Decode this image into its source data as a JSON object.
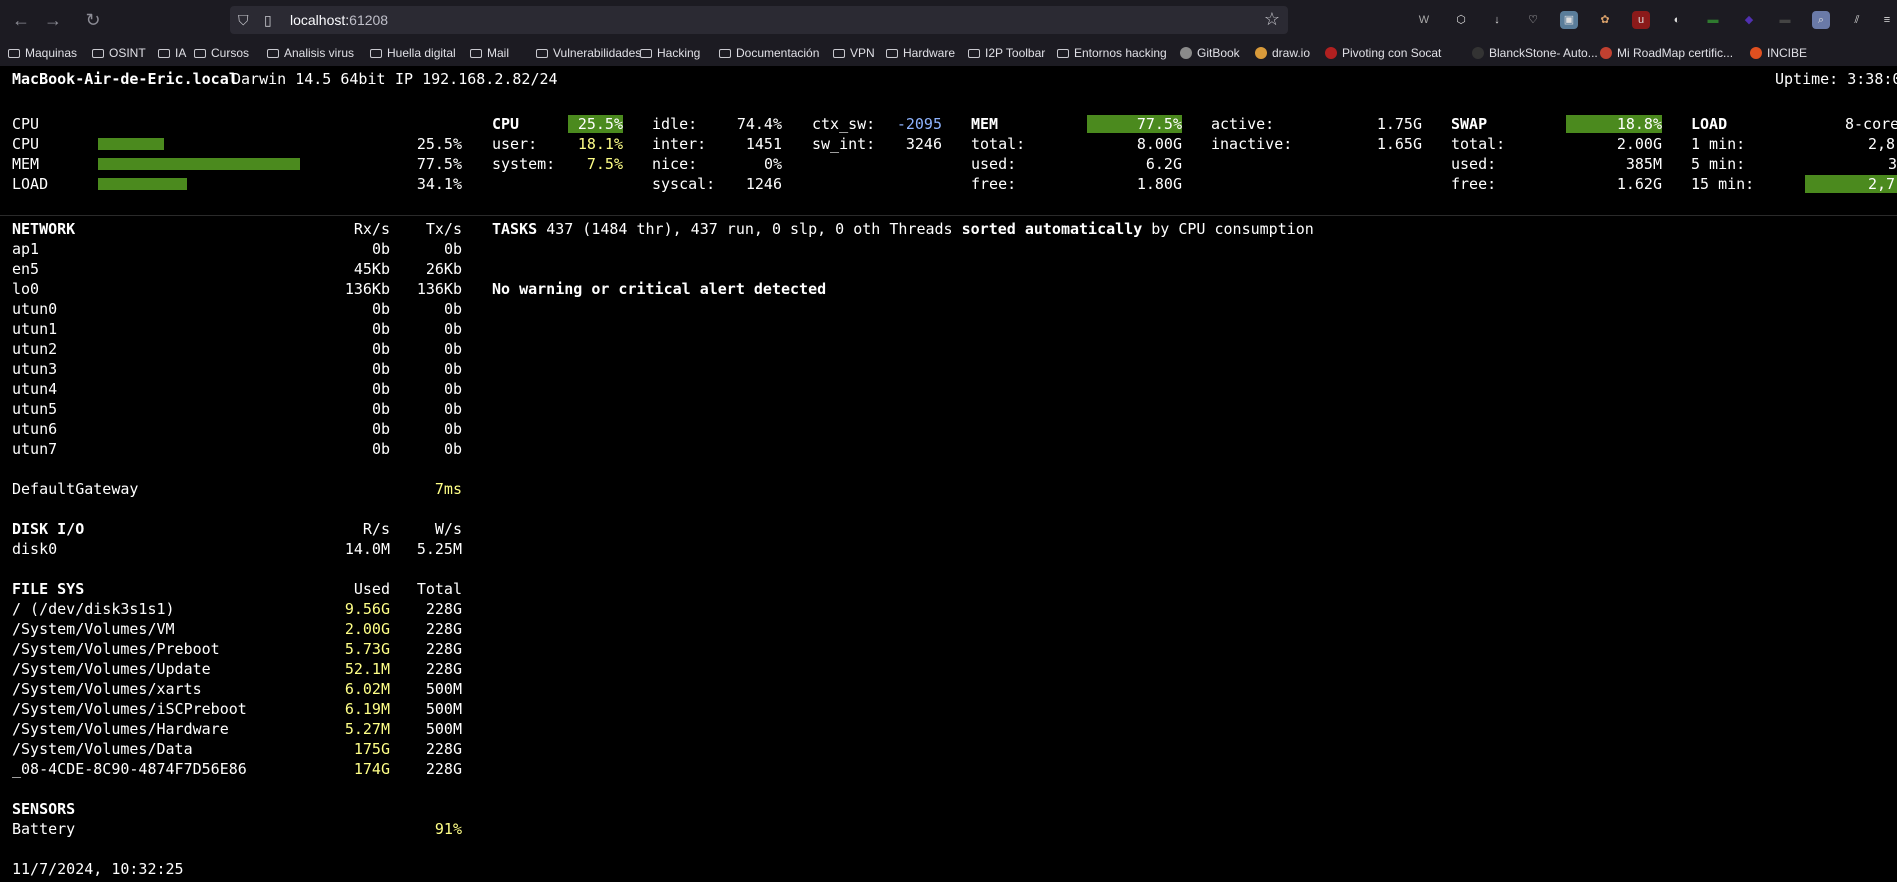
{
  "browser": {
    "url_host": "localhost:",
    "url_port": "61208",
    "bookmarks": [
      {
        "label": "Maquinas",
        "kind": "folder"
      },
      {
        "label": "OSINT",
        "kind": "folder"
      },
      {
        "label": "IA",
        "kind": "folder"
      },
      {
        "label": "Cursos",
        "kind": "folder"
      },
      {
        "label": "Analisis virus",
        "kind": "folder"
      },
      {
        "label": "Huella digital",
        "kind": "folder"
      },
      {
        "label": "Mail",
        "kind": "folder"
      },
      {
        "label": "Vulnerabilidades",
        "kind": "folder"
      },
      {
        "label": "Hacking",
        "kind": "folder"
      },
      {
        "label": "Documentación",
        "kind": "folder"
      },
      {
        "label": "VPN",
        "kind": "folder"
      },
      {
        "label": "Hardware",
        "kind": "folder"
      },
      {
        "label": "I2P Toolbar",
        "kind": "folder"
      },
      {
        "label": "Entornos hacking",
        "kind": "folder"
      },
      {
        "label": "GitBook",
        "kind": "site"
      },
      {
        "label": "draw.io",
        "kind": "site"
      },
      {
        "label": "Pivoting con Socat",
        "kind": "site"
      },
      {
        "label": "BlanckStone- Auto...",
        "kind": "site"
      },
      {
        "label": "Mi RoadMap certific...",
        "kind": "site"
      },
      {
        "label": "INCIBE",
        "kind": "site"
      }
    ]
  },
  "header": {
    "hostname": "MacBook-Air-de-Eric.local",
    "os": "Darwin 14.5 64bit",
    "ip": "IP 192.168.2.82/24",
    "uptime": "Uptime: 3:38:0"
  },
  "quicklook": {
    "rows": [
      {
        "label": "CPU",
        "value": "",
        "fill": null
      },
      {
        "label": "CPU",
        "value": "25.5%",
        "fill": 0.255
      },
      {
        "label": "MEM",
        "value": "77.5%",
        "fill": 0.775
      },
      {
        "label": "LOAD",
        "value": "34.1%",
        "fill": 0.341
      }
    ]
  },
  "cpu": {
    "title": "CPU",
    "total": "25.5%",
    "total_fraction": 0.255,
    "user_label": "user:",
    "user": "18.1%",
    "system_label": "system:",
    "system": "7.5%",
    "idle_label": "idle:",
    "idle": "74.4%",
    "inter_label": "inter:",
    "inter": "1451",
    "nice_label": "nice:",
    "nice": "0%",
    "syscal_label": "syscal:",
    "syscal": "1246",
    "ctx_sw_label": "ctx_sw:",
    "ctx_sw": "-2095",
    "sw_int_label": "sw_int:",
    "sw_int": "3246"
  },
  "mem": {
    "title": "MEM",
    "percent": "77.5%",
    "percent_fraction": 0.775,
    "total_label": "total:",
    "total": "8.00G",
    "used_label": "used:",
    "used": "6.2G",
    "free_label": "free:",
    "free": "1.80G",
    "active_label": "active:",
    "active": "1.75G",
    "inactive_label": "inactive:",
    "inactive": "1.65G"
  },
  "swap": {
    "title": "SWAP",
    "percent": "18.8%",
    "percent_fraction": 0.188,
    "total_label": "total:",
    "total": "2.00G",
    "used_label": "used:",
    "used": "385M",
    "free_label": "free:",
    "free": "1.62G"
  },
  "load": {
    "title": "LOAD",
    "cores": "8-core",
    "min1_label": "1 min:",
    "min1": "2,8",
    "min5_label": "5 min:",
    "min5": "3",
    "min15_label": "15 min:",
    "min15": "2,7"
  },
  "network": {
    "title": "NETWORK",
    "rx_header": "Rx/s",
    "tx_header": "Tx/s",
    "rows": [
      {
        "name": "ap1",
        "rx": "0b",
        "tx": "0b"
      },
      {
        "name": "en5",
        "rx": "45Kb",
        "tx": "26Kb"
      },
      {
        "name": "lo0",
        "rx": "136Kb",
        "tx": "136Kb"
      },
      {
        "name": "utun0",
        "rx": "0b",
        "tx": "0b"
      },
      {
        "name": "utun1",
        "rx": "0b",
        "tx": "0b"
      },
      {
        "name": "utun2",
        "rx": "0b",
        "tx": "0b"
      },
      {
        "name": "utun3",
        "rx": "0b",
        "tx": "0b"
      },
      {
        "name": "utun4",
        "rx": "0b",
        "tx": "0b"
      },
      {
        "name": "utun5",
        "rx": "0b",
        "tx": "0b"
      },
      {
        "name": "utun6",
        "rx": "0b",
        "tx": "0b"
      },
      {
        "name": "utun7",
        "rx": "0b",
        "tx": "0b"
      }
    ]
  },
  "gateway": {
    "label": "DefaultGateway",
    "value": "7ms"
  },
  "disk": {
    "title": "DISK I/O",
    "r_header": "R/s",
    "w_header": "W/s",
    "rows": [
      {
        "name": "disk0",
        "r": "14.0M",
        "w": "5.25M"
      }
    ]
  },
  "fs": {
    "title": "FILE SYS",
    "used_header": "Used",
    "total_header": "Total",
    "rows": [
      {
        "name": "/ (/dev/disk3s1s1)",
        "used": "9.56G",
        "total": "228G"
      },
      {
        "name": "/System/Volumes/VM",
        "used": "2.00G",
        "total": "228G"
      },
      {
        "name": "/System/Volumes/Preboot",
        "used": "5.73G",
        "total": "228G"
      },
      {
        "name": "/System/Volumes/Update",
        "used": "52.1M",
        "total": "228G"
      },
      {
        "name": "/System/Volumes/xarts",
        "used": "6.02M",
        "total": "500M"
      },
      {
        "name": "/System/Volumes/iSCPreboot",
        "used": "6.19M",
        "total": "500M"
      },
      {
        "name": "/System/Volumes/Hardware",
        "used": "5.27M",
        "total": "500M"
      },
      {
        "name": "/System/Volumes/Data",
        "used": "175G",
        "total": "228G"
      },
      {
        "name": "_08-4CDE-8C90-4874F7D56E86",
        "used": "174G",
        "total": "228G"
      }
    ]
  },
  "sensors": {
    "title": "SENSORS",
    "rows": [
      {
        "name": "Battery",
        "value": "91%"
      }
    ]
  },
  "tasks": {
    "prefix": "TASKS",
    "summary": "437 (1484 thr), 437 run, 0 slp, 0 oth Threads",
    "sorted": "sorted automatically",
    "suffix": "by CPU consumption"
  },
  "alert": "No warning or critical alert detected",
  "footer": {
    "datetime": "11/7/2024, 10:32:25"
  },
  "colors": {
    "bar": "#4b8a1e",
    "highlight": "#ffff87",
    "background": "#000000"
  }
}
